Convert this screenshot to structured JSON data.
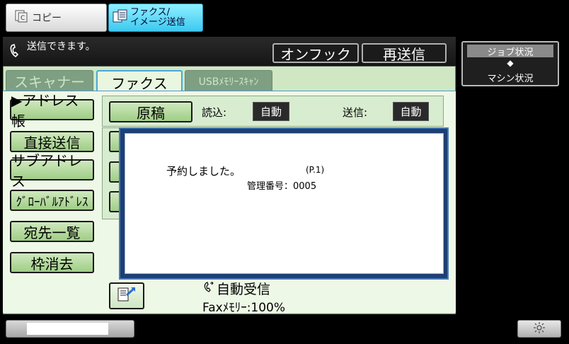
{
  "modes": {
    "copy_label": "コピー",
    "fax_label_line1": "ファクス/",
    "fax_label_line2": "イメージ送信"
  },
  "status": {
    "message": "送信できます。",
    "onhook_label": "オンフック",
    "resend_label": "再送信"
  },
  "tabs": {
    "scanner": "スキャナー",
    "fax": "ファクス",
    "usb": "USBﾒﾓﾘｰｽｷｬﾝ"
  },
  "sidebar": {
    "items": [
      {
        "label": "▶アドレス帳"
      },
      {
        "label": "直接送信"
      },
      {
        "label": "サブアドレス"
      },
      {
        "label": "ｸﾞﾛｰﾊﾞﾙｱﾄﾞﾚｽ"
      },
      {
        "label": "宛先一覧"
      },
      {
        "label": "枠消去"
      }
    ]
  },
  "scan": {
    "original_label": "原稿",
    "read_label": "読込:",
    "read_value": "自動",
    "send_label": "送信:",
    "send_value": "自動"
  },
  "dialog": {
    "message": "予約しました。",
    "page": "(P.1)",
    "management_number": "管理番号：0005"
  },
  "footer": {
    "auto_receive": "自動受信",
    "fax_memory": "Faxﾒﾓﾘｰ:100%"
  },
  "job_status": {
    "top_label": "ジョブ状況",
    "arrow": "◆",
    "bottom_label": "マシン状況"
  },
  "colors": {
    "accent": "#49a9d9",
    "panel_green": "#cfe8c3",
    "dialog_border": "#1d3f74"
  }
}
